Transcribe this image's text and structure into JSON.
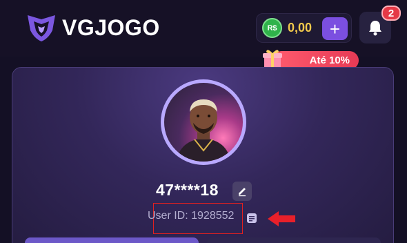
{
  "header": {
    "brand": "VGJOGO",
    "balance": {
      "currency_symbol": "R$",
      "amount": "0,00",
      "add_label": "+"
    },
    "notifications": {
      "count": "2"
    },
    "promo": {
      "label": "Até 10%"
    }
  },
  "profile": {
    "username": "47****18",
    "user_id_text": "User ID: 1928552"
  },
  "colors": {
    "background": "#141025",
    "accent_purple": "#7b4fe0",
    "balance_gold": "#f2c94c",
    "promo_red": "#e63a55",
    "highlight_red": "#e02020"
  }
}
